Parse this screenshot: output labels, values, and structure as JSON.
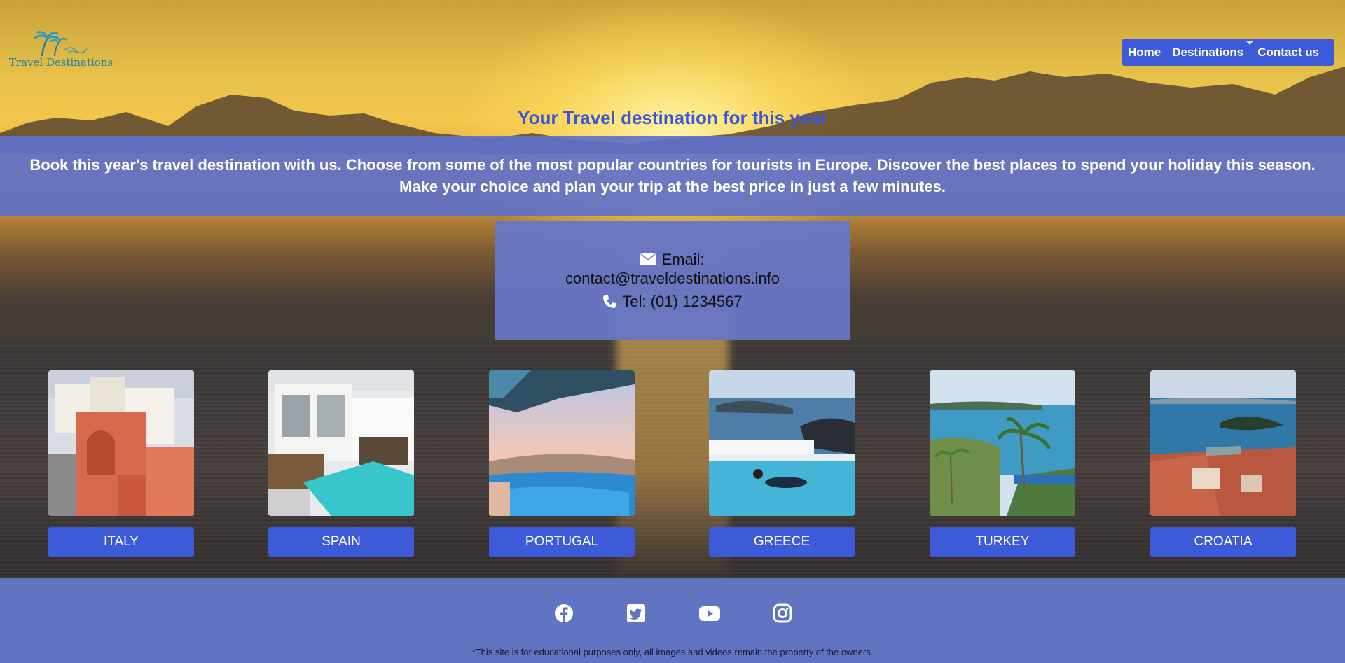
{
  "header": {
    "logo_text": "Travel Destinations",
    "nav": [
      {
        "label": "Home"
      },
      {
        "label": "Destinations"
      },
      {
        "label": "Contact us"
      }
    ]
  },
  "hero": {
    "headline": "Your Travel destination for this year",
    "intro_line1": "Book this year's travel destination with us. Choose from some of the most popular countries for tourists in Europe. Discover the best places to spend your holiday this season.",
    "intro_line2": "Make your choice and plan your trip at the best price in just a few minutes."
  },
  "contact": {
    "email_label": "Email:",
    "email": "contact@traveldestinations.info",
    "tel": "Tel: (01) 1234567"
  },
  "destinations": [
    {
      "label": "ITALY",
      "icon": "italy-photo"
    },
    {
      "label": "SPAIN",
      "icon": "spain-photo"
    },
    {
      "label": "PORTUGAL",
      "icon": "portugal-photo"
    },
    {
      "label": "GREECE",
      "icon": "greece-photo"
    },
    {
      "label": "TURKEY",
      "icon": "turkey-photo"
    },
    {
      "label": "CROATIA",
      "icon": "croatia-photo"
    }
  ],
  "footer": {
    "social": [
      "facebook-icon",
      "twitter-icon",
      "youtube-icon",
      "instagram-icon"
    ],
    "disclaimer": "*This site is for educational purposes only, all images and videos remain the property of the owners."
  },
  "colors": {
    "accent": "#3d5ad8",
    "banner": "#5f70c8",
    "footer": "#6074c2",
    "headline": "#3b55d6"
  }
}
